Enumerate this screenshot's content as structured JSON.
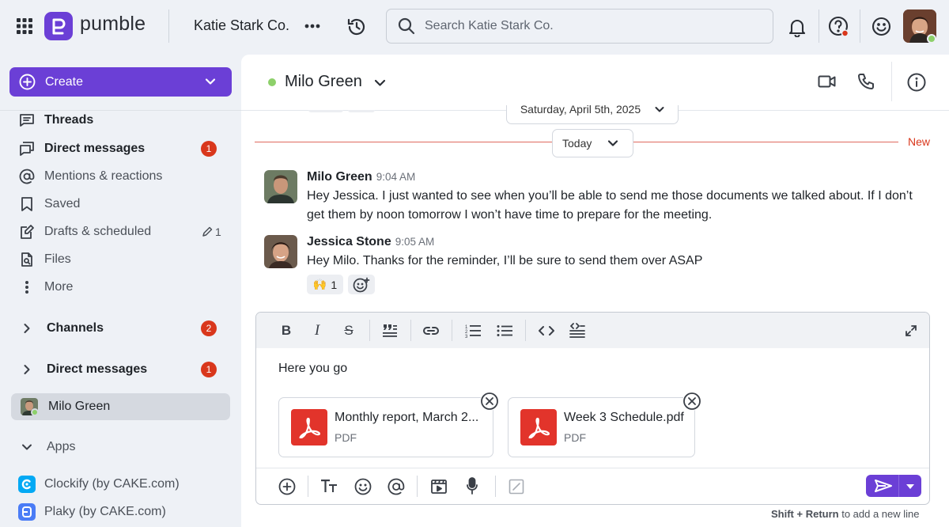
{
  "app": {
    "name": "pumble",
    "workspace": "Katie Stark Co."
  },
  "search": {
    "placeholder": "Search Katie Stark Co."
  },
  "sidebar": {
    "create_label": "Create",
    "items": [
      {
        "label": "Threads",
        "bold": true
      },
      {
        "label": "Direct messages",
        "bold": true,
        "badge": "1"
      },
      {
        "label": "Mentions & reactions"
      },
      {
        "label": "Saved"
      },
      {
        "label": "Drafts & scheduled",
        "count": "1"
      },
      {
        "label": "Files"
      },
      {
        "label": "More"
      }
    ],
    "sections": {
      "channels": {
        "label": "Channels",
        "badge": "2"
      },
      "direct_messages": {
        "label": "Direct messages",
        "badge": "1"
      },
      "selected_dm": "Milo Green",
      "apps": {
        "label": "Apps",
        "items": [
          "Clockify (by CAKE.com)",
          "Plaky (by CAKE.com)"
        ]
      }
    }
  },
  "conversation": {
    "title": "Milo Green",
    "prev_date": "Saturday, April 5th, 2025",
    "today_label": "Today",
    "new_label": "New",
    "messages": [
      {
        "author": "Milo Green",
        "time": "9:04 AM",
        "text": "Hey Jessica. I just wanted to see when you’ll be able to send me those documents we talked about. If I don’t get them by noon tomorrow I won’t have time to prepare for the meeting."
      },
      {
        "author": "Jessica Stone",
        "time": "9:05 AM",
        "text": "Hey Milo. Thanks for the reminder, I’ll be sure to send them over ASAP",
        "reaction": {
          "emoji": "🙌",
          "count": "1"
        }
      }
    ]
  },
  "composer": {
    "text": "Here you go",
    "attachments": [
      {
        "name": "Monthly report, March 2...",
        "type": "PDF"
      },
      {
        "name": "Week 3 Schedule.pdf",
        "type": "PDF"
      }
    ],
    "hint_bold": "Shift + Return",
    "hint_rest": " to add a new line"
  },
  "colors": {
    "brand": "#6b3fd6",
    "badge": "#d9371c",
    "online": "#8dd06a",
    "new_line": "#e06a5e"
  }
}
